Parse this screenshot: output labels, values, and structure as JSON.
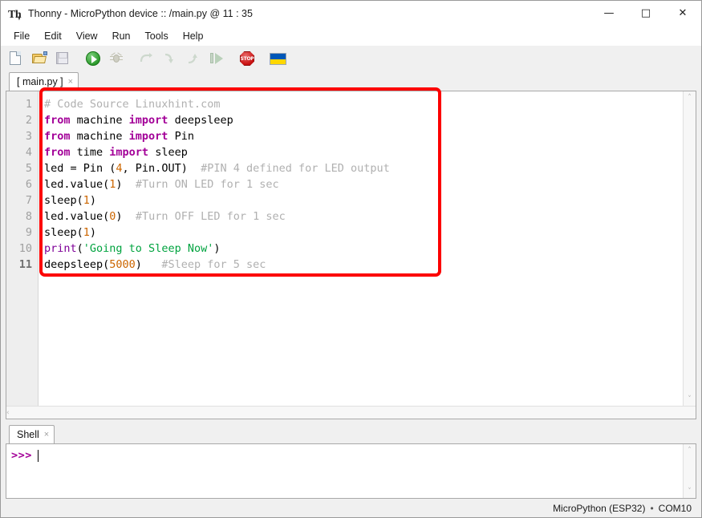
{
  "window": {
    "title": "Thonny  -  MicroPython device :: /main.py  @  11 : 35",
    "app_icon": "thonny-logo-icon",
    "minimize": "—",
    "maximize": "□",
    "close": "✕"
  },
  "menu": {
    "items": [
      {
        "label": "File"
      },
      {
        "label": "Edit"
      },
      {
        "label": "View"
      },
      {
        "label": "Run"
      },
      {
        "label": "Tools"
      },
      {
        "label": "Help"
      }
    ]
  },
  "toolbar": {
    "items": [
      {
        "name": "new-file-icon",
        "tooltip": "New",
        "enabled": true
      },
      {
        "name": "open-file-icon",
        "tooltip": "Load",
        "enabled": true
      },
      {
        "name": "save-file-icon",
        "tooltip": "Save",
        "enabled": false
      },
      {
        "name": "run-icon",
        "tooltip": "Run current script",
        "enabled": true
      },
      {
        "name": "debug-icon",
        "tooltip": "Debug current script",
        "enabled": false
      },
      {
        "name": "step-over-icon",
        "tooltip": "Step over",
        "enabled": false
      },
      {
        "name": "step-into-icon",
        "tooltip": "Step into",
        "enabled": false
      },
      {
        "name": "step-out-icon",
        "tooltip": "Step out",
        "enabled": false
      },
      {
        "name": "resume-icon",
        "tooltip": "Resume",
        "enabled": false
      },
      {
        "name": "stop-icon",
        "tooltip": "Stop/Restart backend",
        "enabled": true
      },
      {
        "name": "ukraine-flag-icon",
        "tooltip": "Support Ukraine",
        "enabled": true
      }
    ],
    "stop_label": "STOP"
  },
  "editor": {
    "tab": {
      "label": "[ main.py ]",
      "close": "×"
    },
    "current_line": 11,
    "lines": [
      {
        "n": "1",
        "tokens": [
          {
            "t": "# Code Source Linuxhint.com",
            "c": "cmt"
          }
        ]
      },
      {
        "n": "2",
        "tokens": [
          {
            "t": "from",
            "c": "kw"
          },
          {
            "t": " machine "
          },
          {
            "t": "import",
            "c": "kw"
          },
          {
            "t": " deepsleep"
          }
        ]
      },
      {
        "n": "3",
        "tokens": [
          {
            "t": "from",
            "c": "kw"
          },
          {
            "t": " machine "
          },
          {
            "t": "import",
            "c": "kw"
          },
          {
            "t": " Pin"
          }
        ]
      },
      {
        "n": "4",
        "tokens": [
          {
            "t": "from",
            "c": "kw"
          },
          {
            "t": " time "
          },
          {
            "t": "import",
            "c": "kw"
          },
          {
            "t": " sleep"
          }
        ]
      },
      {
        "n": "5",
        "tokens": [
          {
            "t": "led = Pin ("
          },
          {
            "t": "4",
            "c": "num"
          },
          {
            "t": ", Pin.OUT)  "
          },
          {
            "t": "#PIN 4 defined for LED output",
            "c": "cmt"
          }
        ]
      },
      {
        "n": "6",
        "tokens": [
          {
            "t": "led.value("
          },
          {
            "t": "1",
            "c": "num"
          },
          {
            "t": ")  "
          },
          {
            "t": "#Turn ON LED for 1 sec",
            "c": "cmt"
          }
        ]
      },
      {
        "n": "7",
        "tokens": [
          {
            "t": "sleep("
          },
          {
            "t": "1",
            "c": "num"
          },
          {
            "t": ")"
          }
        ]
      },
      {
        "n": "8",
        "tokens": [
          {
            "t": "led.value("
          },
          {
            "t": "0",
            "c": "num"
          },
          {
            "t": ")  "
          },
          {
            "t": "#Turn OFF LED for 1 sec",
            "c": "cmt"
          }
        ]
      },
      {
        "n": "9",
        "tokens": [
          {
            "t": "sleep("
          },
          {
            "t": "1",
            "c": "num"
          },
          {
            "t": ")"
          }
        ]
      },
      {
        "n": "10",
        "tokens": [
          {
            "t": "print",
            "c": "bi"
          },
          {
            "t": "("
          },
          {
            "t": "'Going to Sleep Now'",
            "c": "str"
          },
          {
            "t": ")"
          }
        ]
      },
      {
        "n": "11",
        "tokens": [
          {
            "t": "deepsleep("
          },
          {
            "t": "5000",
            "c": "num"
          },
          {
            "t": ")   "
          },
          {
            "t": "#Sleep for 5 sec",
            "c": "cmt"
          }
        ]
      }
    ],
    "scroll_up": "˄",
    "scroll_down": "˅",
    "scroll_left": "‹",
    "scroll_right": "›"
  },
  "annotation": {
    "name": "red-highlight-rectangle",
    "color": "#fc0000"
  },
  "shell": {
    "tab": {
      "label": "Shell",
      "close": "×"
    },
    "prompt": ">>>",
    "input_value": "",
    "scroll_up": "˄",
    "scroll_down": "˅"
  },
  "statusbar": {
    "interpreter": "MicroPython (ESP32)",
    "separator": "•",
    "port": "COM10"
  }
}
